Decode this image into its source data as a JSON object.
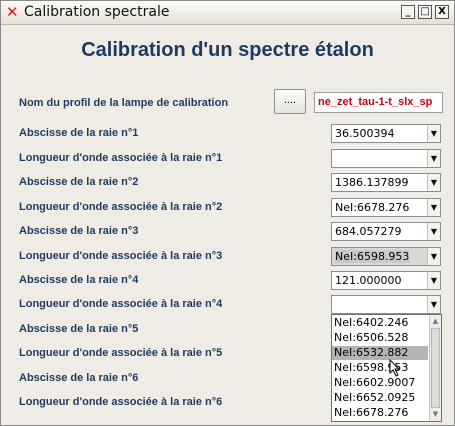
{
  "window": {
    "title": "Calibration spectrale",
    "controls": {
      "minimize": "_",
      "maximize": "□",
      "close": "X"
    }
  },
  "heading": "Calibration d'un spectre étalon",
  "profile": {
    "label": "Nom du profil de la lampe de calibration",
    "browse_label": "....",
    "value": "ne_zet_tau-1-t_slx_sp"
  },
  "rows": [
    {
      "label": "Abscisse de la raie n°1",
      "value": "36.500394"
    },
    {
      "label": "Longueur d'onde associée à la raie n°1",
      "value": ""
    },
    {
      "label": "Abscisse de la raie n°2",
      "value": "1386.137899"
    },
    {
      "label": "Longueur d'onde associée à la raie n°2",
      "value": "NeI:6678.276"
    },
    {
      "label": "Abscisse de la raie n°3",
      "value": "684.057279"
    },
    {
      "label": "Longueur d'onde associée à la raie n°3",
      "value": "NeI:6598.953"
    },
    {
      "label": "Abscisse de la raie n°4",
      "value": "121.000000"
    },
    {
      "label": "Longueur d'onde associée à la raie n°4",
      "value": ""
    },
    {
      "label": "Abscisse de la raie n°5"
    },
    {
      "label": "Longueur d'onde associée à la raie n°5"
    },
    {
      "label": "Abscisse de la raie n°6"
    },
    {
      "label": "Longueur d'onde associée à la raie n°6"
    }
  ],
  "dropdown": {
    "options": [
      "NeI:6402.246",
      "NeI:6506.528",
      "NeI:6532.882",
      "NeI:6598.953",
      "NeI:6602.9007",
      "NeI:6652.0925",
      "NeI:6678.276"
    ],
    "highlighted_index": 2
  }
}
